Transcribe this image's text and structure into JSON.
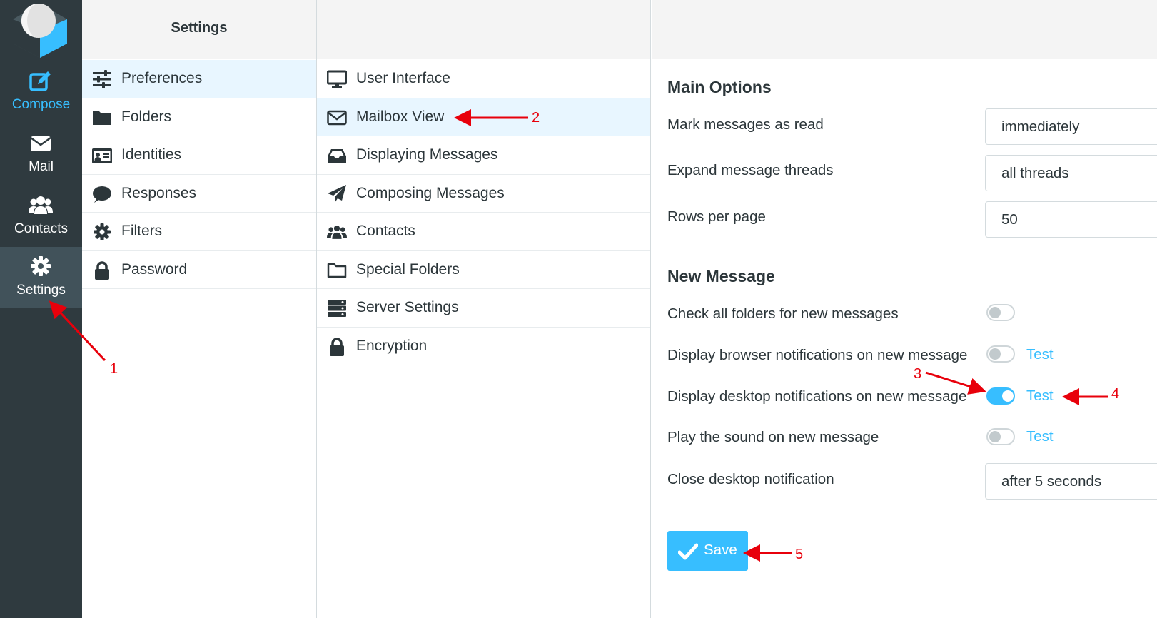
{
  "nav": {
    "compose": "Compose",
    "mail": "Mail",
    "contacts": "Contacts",
    "settings": "Settings"
  },
  "settings_panel": {
    "title": "Settings",
    "items": [
      "Preferences",
      "Folders",
      "Identities",
      "Responses",
      "Filters",
      "Password"
    ],
    "selected": "Preferences"
  },
  "sections_panel": {
    "items": [
      "User Interface",
      "Mailbox View",
      "Displaying Messages",
      "Composing Messages",
      "Contacts",
      "Special Folders",
      "Server Settings",
      "Encryption"
    ],
    "selected": "Mailbox View"
  },
  "main": {
    "main_options": {
      "title": "Main Options",
      "mark_read_label": "Mark messages as read",
      "mark_read_value": "immediately",
      "expand_threads_label": "Expand message threads",
      "expand_threads_value": "all threads",
      "rows_label": "Rows per page",
      "rows_value": "50"
    },
    "new_message": {
      "title": "New Message",
      "check_all_label": "Check all folders for new messages",
      "check_all_on": false,
      "browser_notif_label": "Display browser notifications on new message",
      "browser_notif_on": false,
      "desktop_notif_label": "Display desktop notifications on new message",
      "desktop_notif_on": true,
      "sound_label": "Play the sound on new message",
      "sound_on": false,
      "test_label": "Test",
      "close_notif_label": "Close desktop notification",
      "close_notif_value": "after 5 seconds"
    },
    "save_label": "Save"
  },
  "annotations": [
    "1",
    "2",
    "3",
    "4",
    "5"
  ],
  "colors": {
    "accent": "#37beff",
    "nav_bg": "#2f3a3f",
    "nav_selected": "#41525a",
    "annotation": "#e8000b"
  }
}
